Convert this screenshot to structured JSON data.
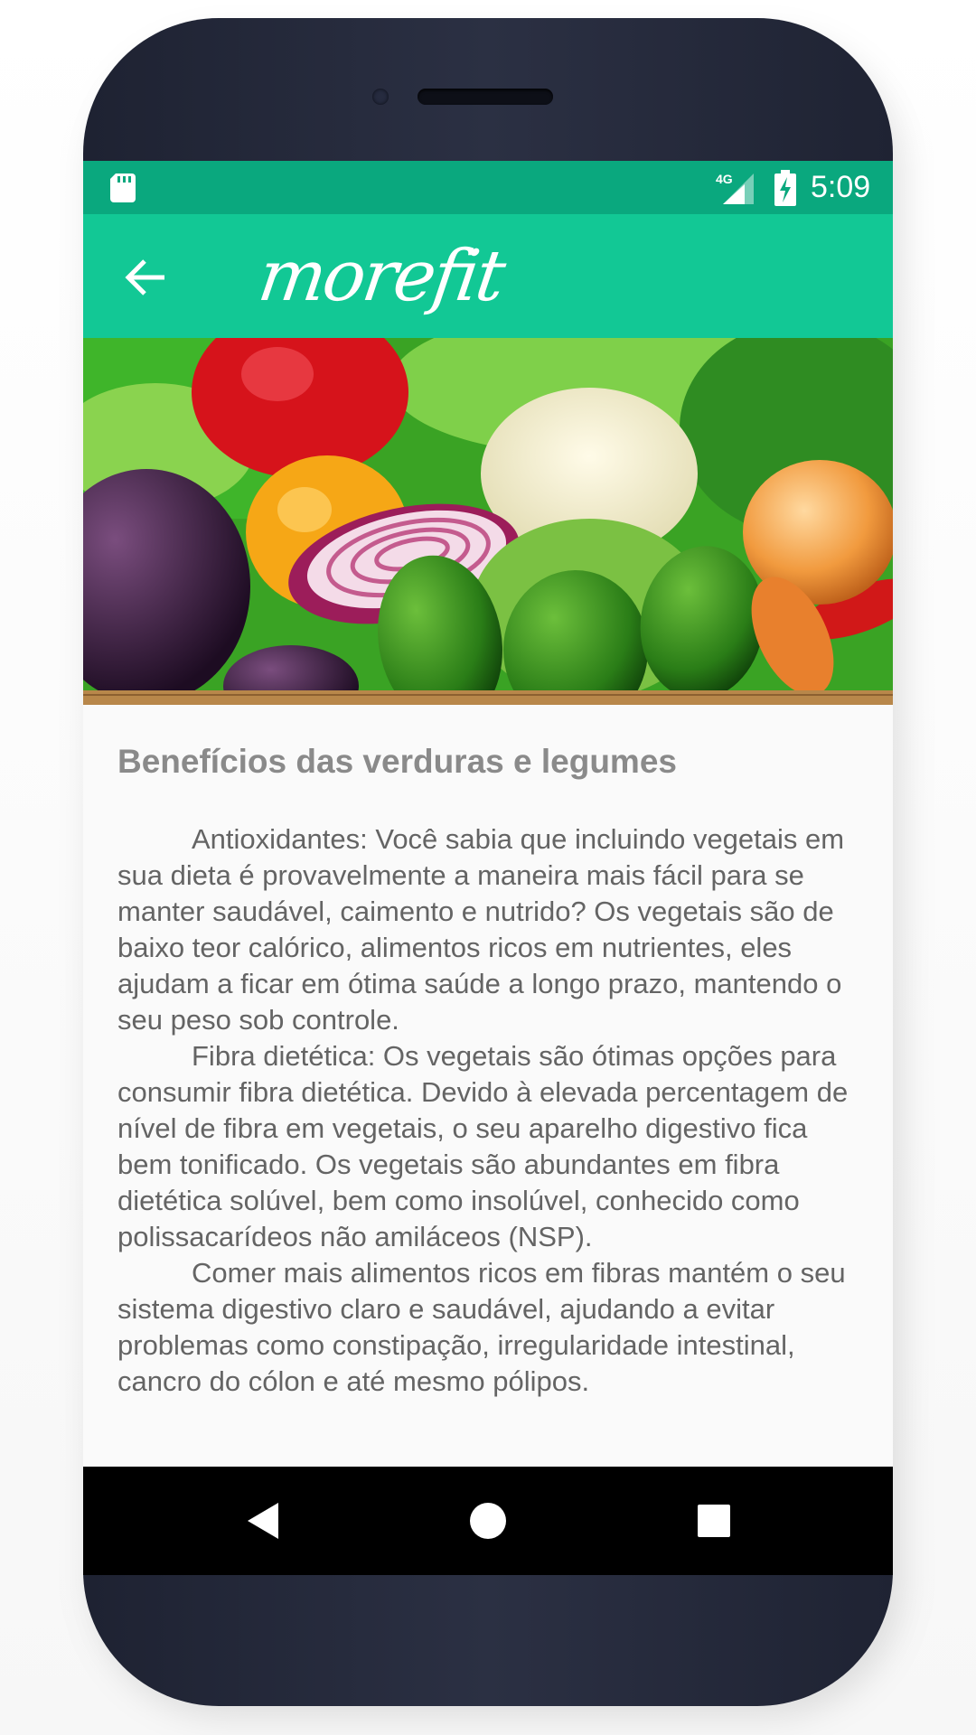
{
  "status_bar": {
    "network_label": "4G",
    "time": "5:09",
    "color": "#0aa87e"
  },
  "app_bar": {
    "logo_text": "morefit",
    "color": "#12c895",
    "back_icon": "arrow-left-icon"
  },
  "hero": {
    "icon": "vegetables-image"
  },
  "article": {
    "title": "Benefícios das verduras e legumes",
    "paragraphs": [
      "Antioxidantes: Você sabia que incluindo vegetais em sua dieta é provavelmente a maneira mais fácil para se manter saudável, caimento e nutrido? Os vegetais são de baixo teor calórico, alimentos ricos em nutrientes, eles ajudam a ficar em ótima saúde a longo prazo, mantendo o seu peso sob controle.",
      "Fibra dietética: Os vegetais são ótimas opções para consumir fibra dietética. Devido à elevada percentagem de nível de fibra em vegetais, o seu aparelho digestivo fica bem tonificado. Os vegetais são abundantes em fibra dietética solúvel, bem como insolúvel, conhecido como polissacarídeos não amiláceos (NSP).",
      "Comer mais alimentos ricos em fibras mantém o seu sistema digestivo claro e saudável, ajudando a evitar problemas como constipação, irregularidade intestinal, cancro do cólon e até mesmo pólipos."
    ]
  },
  "nav_bar": {
    "back_icon": "triangle-back-icon",
    "home_icon": "circle-home-icon",
    "recents_icon": "square-recents-icon"
  }
}
